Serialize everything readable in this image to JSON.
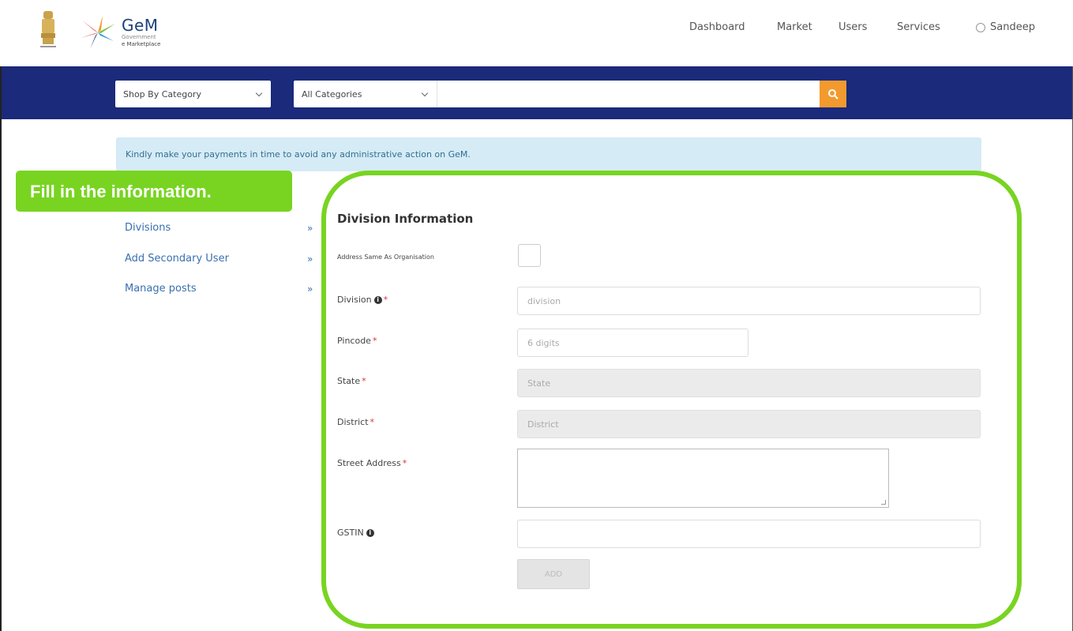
{
  "header": {
    "brand_name": "GeM",
    "brand_sub1": "Government",
    "brand_sub2": "e Marketplace",
    "nav": [
      "Dashboard",
      "Market",
      "Users",
      "Services"
    ],
    "user": "Sandeep"
  },
  "searchbar": {
    "category_select": "Shop By Category",
    "all_categories_select": "All Categories",
    "search_value": "",
    "search_icon": "search-icon",
    "button_color": "#f29a2e",
    "bar_color": "#1b2a7a"
  },
  "alert": {
    "text": "Kindly make your payments in time to avoid any administrative action on GeM."
  },
  "callout": {
    "text": "Fill in the information.",
    "color": "#78d421"
  },
  "sidebar": {
    "items": [
      {
        "label": "Divisions",
        "arrow": "»"
      },
      {
        "label": "Add Secondary User",
        "arrow": "»"
      },
      {
        "label": "Manage posts",
        "arrow": "»"
      }
    ]
  },
  "form": {
    "title": "Division Information",
    "address_same_label": "Address Same As Organisation",
    "address_same_checked": false,
    "division_label": "Division",
    "division_placeholder": "division",
    "pincode_label": "Pincode",
    "pincode_placeholder": "6 digits",
    "state_label": "State",
    "state_placeholder": "State",
    "district_label": "District",
    "district_placeholder": "District",
    "street_label": "Street Address",
    "gstin_label": "GSTIN",
    "required_mark": "*",
    "info_mark": "i",
    "add_button": "ADD"
  }
}
